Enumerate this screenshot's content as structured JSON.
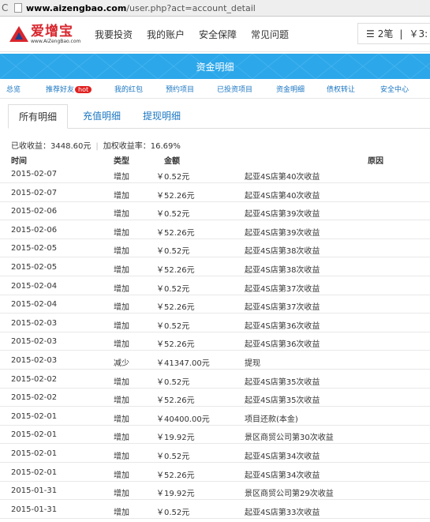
{
  "browser": {
    "url_host": "www.aizengbao.com",
    "url_path": "/user.php?act=account_detail"
  },
  "header": {
    "brand": "爱增宝",
    "brand_url": "www.AiZengBao.com",
    "nav": [
      "我要投资",
      "我的账户",
      "安全保障",
      "常见问题"
    ],
    "cart_count": "2笔",
    "cart_sep": "|",
    "cart_amount": "￥3:"
  },
  "banner": {
    "title": "资金明细"
  },
  "subnav": {
    "items": [
      "总览",
      "推荐好友",
      "我的红包",
      "预约项目",
      "已投资项目",
      "资金明细",
      "债权转让",
      "安全中心"
    ],
    "hot_badge": "hot"
  },
  "tabs": [
    "所有明细",
    "充值明细",
    "提现明细"
  ],
  "summary": {
    "income": "已收收益：3448.60元",
    "rate": "加权收益率：16.69%"
  },
  "table": {
    "headers": [
      "时间",
      "类型",
      "金额",
      "原因"
    ],
    "rows": [
      [
        "2015-02-07",
        "增加",
        "￥0.52元",
        "起亚4S店第40次收益"
      ],
      [
        "2015-02-07",
        "增加",
        "￥52.26元",
        "起亚4S店第40次收益"
      ],
      [
        "2015-02-06",
        "增加",
        "￥0.52元",
        "起亚4S店第39次收益"
      ],
      [
        "2015-02-06",
        "增加",
        "￥52.26元",
        "起亚4S店第39次收益"
      ],
      [
        "2015-02-05",
        "增加",
        "￥0.52元",
        "起亚4S店第38次收益"
      ],
      [
        "2015-02-05",
        "增加",
        "￥52.26元",
        "起亚4S店第38次收益"
      ],
      [
        "2015-02-04",
        "增加",
        "￥0.52元",
        "起亚4S店第37次收益"
      ],
      [
        "2015-02-04",
        "增加",
        "￥52.26元",
        "起亚4S店第37次收益"
      ],
      [
        "2015-02-03",
        "增加",
        "￥0.52元",
        "起亚4S店第36次收益"
      ],
      [
        "2015-02-03",
        "增加",
        "￥52.26元",
        "起亚4S店第36次收益"
      ],
      [
        "2015-02-03",
        "减少",
        "￥41347.00元",
        "提现"
      ],
      [
        "2015-02-02",
        "增加",
        "￥0.52元",
        "起亚4S店第35次收益"
      ],
      [
        "2015-02-02",
        "增加",
        "￥52.26元",
        "起亚4S店第35次收益"
      ],
      [
        "2015-02-01",
        "增加",
        "￥40400.00元",
        "项目还款(本金)"
      ],
      [
        "2015-02-01",
        "增加",
        "￥19.92元",
        "景区商贸公司第30次收益"
      ],
      [
        "2015-02-01",
        "增加",
        "￥0.52元",
        "起亚4S店第34次收益"
      ],
      [
        "2015-02-01",
        "增加",
        "￥52.26元",
        "起亚4S店第34次收益"
      ],
      [
        "2015-01-31",
        "增加",
        "￥19.92元",
        "景区商贸公司第29次收益"
      ],
      [
        "2015-01-31",
        "增加",
        "￥0.52元",
        "起亚4S店第33次收益"
      ]
    ]
  },
  "colors": {
    "banner": "#2ca7ea",
    "link": "#1a76c2",
    "brand_red": "#d8262d",
    "hot": "#e02020"
  }
}
